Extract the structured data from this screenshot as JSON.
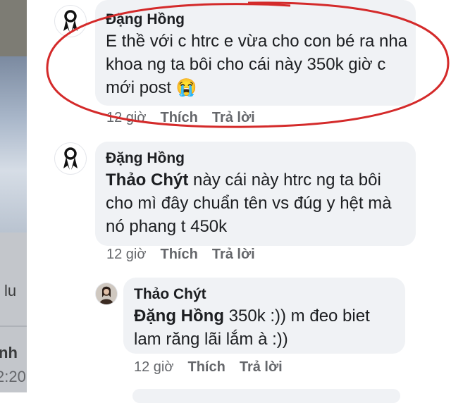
{
  "background": {
    "left_text_1": "lu",
    "left_text_2": "nh",
    "left_text_3": "2:20"
  },
  "comments": [
    {
      "author": "Đặng Hồng",
      "text": "E thề với c htrc e vừa cho con bé ra nha khoa ng ta bôi cho cái này 350k giờ c mới post 😭",
      "time": "12 giờ",
      "like_label": "Thích",
      "reply_label": "Trả lời"
    },
    {
      "author": "Đặng Hồng",
      "mention": "Thảo Chýt",
      "text": " này cái này htrc ng ta bôi cho mì đây chuẩn tên vs đúg y hệt mà nó phang t 450k",
      "time": "12 giờ",
      "like_label": "Thích",
      "reply_label": "Trả lời"
    }
  ],
  "reply": {
    "author": "Thảo Chýt",
    "mention": "Đặng Hồng",
    "text": " 350k :)) m đeo biet lam răng lãi lắm à :))",
    "time": "12 giờ",
    "like_label": "Thích",
    "reply_label": "Trả lời"
  },
  "colors": {
    "bubble": "#f0f2f5",
    "meta_text": "#65676b",
    "annotation_circle": "#d42a2a"
  },
  "icons": {
    "avatar_1": "ribbon-avatar-icon",
    "avatar_2": "ribbon-avatar-icon",
    "avatar_reply": "profile-photo-avatar"
  }
}
